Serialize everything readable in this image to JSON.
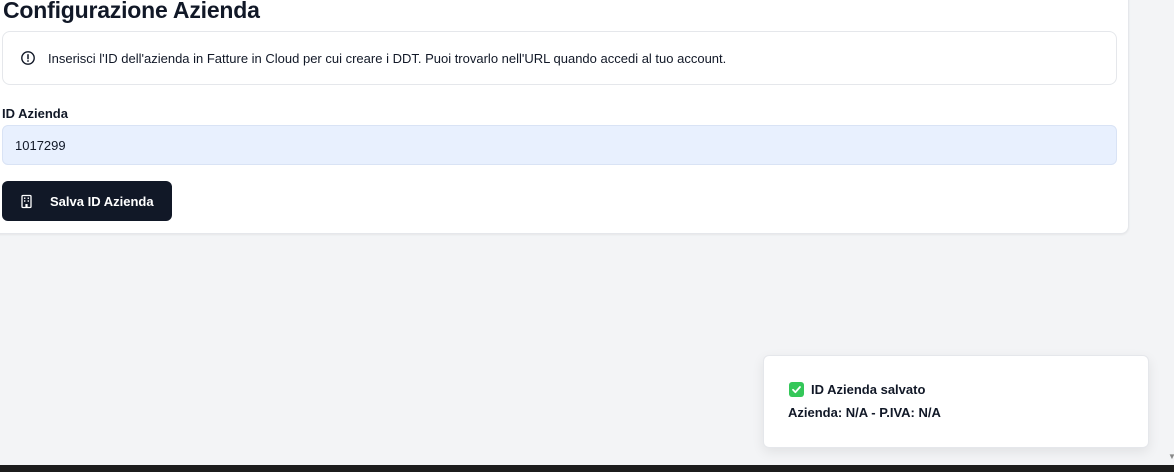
{
  "page": {
    "title": "Configurazione Azienda"
  },
  "alert": {
    "icon": "info-circle-icon",
    "text": "Inserisci l'ID dell'azienda in Fatture in Cloud per cui creare i DDT. Puoi trovarlo nell'URL quando accedi al tuo account."
  },
  "form": {
    "id_label": "ID Azienda",
    "id_value": "1017299",
    "save_icon": "building-icon",
    "save_label": "Salva ID Azienda"
  },
  "toast": {
    "icon": "check-box-icon",
    "title": "ID Azienda salvato",
    "detail": "Azienda: N/A - P.IVA: N/A"
  },
  "colors": {
    "background": "#f3f4f6",
    "button": "#111827",
    "input_bg": "#e8f0fe",
    "success": "#34c759"
  }
}
